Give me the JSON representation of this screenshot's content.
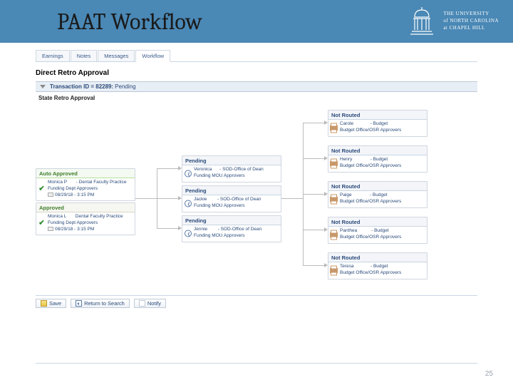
{
  "header": {
    "title": "PAAT Workflow"
  },
  "university": {
    "line1": "THE UNIVERSITY",
    "line2": "of NORTH CAROLINA",
    "line3": "at CHAPEL HILL"
  },
  "tabs": [
    {
      "label": "Earnings"
    },
    {
      "label": "Notes"
    },
    {
      "label": "Messages"
    },
    {
      "label": "Workflow"
    }
  ],
  "section": {
    "title": "Direct Retro Approval"
  },
  "transaction": {
    "label": "Transaction ID = 82289:",
    "status": "Pending"
  },
  "subhead": "State Retro Approval",
  "col1": {
    "auto_approved": {
      "header": "Auto Approved",
      "name": "Monica P",
      "dept": "- Dental Faculty Practice",
      "role": "Funding Dept Approvers",
      "ts_prefix": "08/29/18 - 3:15 PM"
    },
    "approved": {
      "header": "Approved",
      "name": "Monica L",
      "dept": "Dental Faculty Practice",
      "role": "Funding Dept Approvers",
      "ts": "08/29/18 - 3:15 PM"
    }
  },
  "col2": {
    "pending1": {
      "header": "Pending",
      "name": "Veronica",
      "dept": "- SOD-Office of Dean",
      "role": "Funding MOU Approvers"
    },
    "pending2": {
      "header": "Pending",
      "name": "Jackie",
      "dept": "- SOD-Office of Dean",
      "role": "Funding MOU Approvers"
    },
    "pending3": {
      "header": "Pending",
      "name": "Jennie",
      "dept": "- SOD-Office of Dean",
      "role": "Funding MOU Approvers"
    }
  },
  "col3": {
    "nr1": {
      "header": "Not Routed",
      "name": "Carole",
      "dept": "- Budget",
      "role": "Budget Office/OSR Approvers"
    },
    "nr2": {
      "header": "Not Routed",
      "name": "Henry",
      "dept": "- Budget",
      "role": "Budget Office/OSR Approvers"
    },
    "nr3": {
      "header": "Not Routed",
      "name": "Paige",
      "dept": "- Budget",
      "role": "Budget Office/OSR Approvers"
    },
    "nr4": {
      "header": "Not Routed",
      "name": "Panthea",
      "dept": "- Budget",
      "role": "Budget Office/OSR Approvers"
    },
    "nr5": {
      "header": "Not Routed",
      "name": "Teresa",
      "dept": "- Budget",
      "role": "Budget Office/OSR Approvers"
    }
  },
  "actions": {
    "save": "Save",
    "return": "Return to Search",
    "notify": "Notify"
  },
  "page": {
    "number": "25"
  }
}
